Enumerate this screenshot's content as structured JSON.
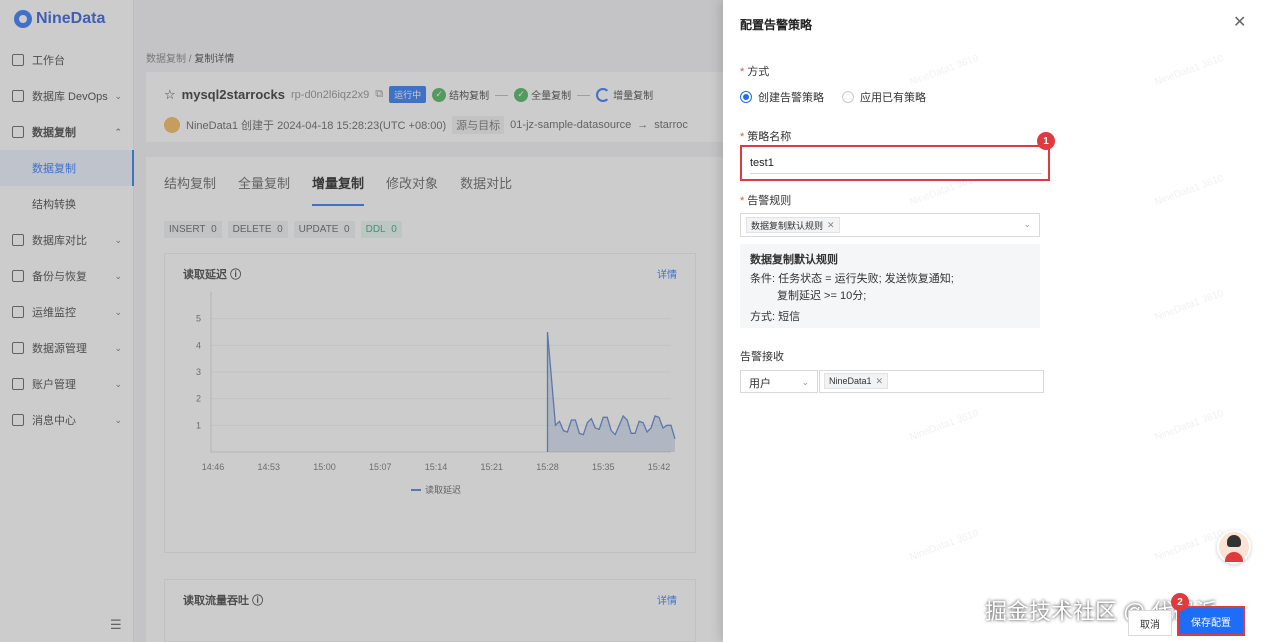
{
  "app": {
    "logo": "NineData"
  },
  "sidebar": {
    "items": [
      {
        "label": "工作台",
        "icon": "home-icon",
        "chevron": ""
      },
      {
        "label": "数据库 DevOps",
        "icon": "database-icon",
        "chevron": "⌄"
      },
      {
        "label": "数据复制",
        "icon": "copy-icon",
        "chevron": "⌃"
      },
      {
        "label": "数据库对比",
        "icon": "compare-icon",
        "chevron": "⌄"
      },
      {
        "label": "备份与恢复",
        "icon": "backup-icon",
        "chevron": "⌄"
      },
      {
        "label": "运维监控",
        "icon": "monitor-icon",
        "chevron": "⌄"
      },
      {
        "label": "数据源管理",
        "icon": "datasource-icon",
        "chevron": "⌄"
      },
      {
        "label": "账户管理",
        "icon": "account-icon",
        "chevron": "⌄"
      },
      {
        "label": "消息中心",
        "icon": "message-icon",
        "chevron": "⌄"
      }
    ],
    "sub_items": [
      {
        "label": "数据复制"
      },
      {
        "label": "结构转换"
      }
    ],
    "collapse_icon": "☰"
  },
  "main": {
    "breadcrumb": {
      "parent": "数据复制",
      "sep": "/",
      "current": "复制详情"
    },
    "task": {
      "star": "☆",
      "name": "mysql2starrocks",
      "id": "rp-d0n2l6iqz2x9",
      "copy_icon": "⧉",
      "status": "运行中",
      "steps": [
        "结构复制",
        "全量复制",
        "增量复制"
      ],
      "step_sep": "—",
      "check": "✓",
      "meta": "NineData1 创建于 2024-04-18 15:28:23(UTC +08:00)",
      "src_label": "源与目标",
      "src_value": "01-jz-sample-datasource",
      "arrow": "→",
      "target": "starroc"
    },
    "tabs": [
      "结构复制",
      "全量复制",
      "增量复制",
      "修改对象",
      "数据对比"
    ],
    "active_tab": 2,
    "counters": [
      {
        "label": "INSERT",
        "value": "0"
      },
      {
        "label": "DELETE",
        "value": "0"
      },
      {
        "label": "UPDATE",
        "value": "0"
      },
      {
        "label": "DDL",
        "value": "0"
      }
    ],
    "panel1": {
      "title": "读取延迟",
      "info_icon": "ⓘ",
      "link": "详情"
    },
    "panel2": {
      "title": "读取流量吞吐",
      "info_icon": "ⓘ",
      "link": "详情"
    }
  },
  "chart_data": {
    "type": "area",
    "title": "读取延迟",
    "series": [
      {
        "name": "读取延迟",
        "x": [
          "15:28",
          "15:29",
          "15:30",
          "15:31",
          "15:32",
          "15:33",
          "15:34",
          "15:35",
          "15:36",
          "15:37",
          "15:38",
          "15:39",
          "15:40",
          "15:41",
          "15:42",
          "15:43",
          "15:44"
        ],
        "values": [
          4.5,
          1.0,
          0.8,
          1.2,
          0.7,
          1.1,
          0.9,
          1.3,
          0.8,
          1.0,
          1.2,
          0.7,
          1.1,
          0.9,
          1.3,
          1.0,
          0.5
        ]
      }
    ],
    "xticks": [
      "14:46",
      "14:53",
      "15:00",
      "15:07",
      "15:14",
      "15:21",
      "15:28",
      "15:35",
      "15:42"
    ],
    "yticks": [
      "1",
      "2",
      "3",
      "4",
      "5"
    ],
    "ylim": [
      0,
      6
    ],
    "grid": true,
    "legend": "bottom",
    "color": "#4a78c8"
  },
  "drawer": {
    "title": "配置告警策略",
    "close_icon": "✕",
    "method": {
      "label": "方式",
      "required": "*",
      "options": [
        {
          "label": "创建告警策略",
          "checked": true
        },
        {
          "label": "应用已有策略",
          "checked": false
        }
      ]
    },
    "name": {
      "label": "策略名称",
      "required": "*",
      "value": "test1",
      "badge": "1"
    },
    "rules": {
      "label": "告警规则",
      "required": "*",
      "tag": "数据复制默认规则",
      "tag_close": "✕",
      "chevron": "⌄",
      "detail_title": "数据复制默认规则",
      "cond_line1": "条件: 任务状态 = 运行失败; 发送恢复通知;",
      "cond_line2": "复制延迟 >= 10分;",
      "method_line": "方式: 短信"
    },
    "receiver": {
      "label": "告警接收",
      "type": "用户",
      "chevron": "⌄",
      "user_tag": "NineData1",
      "tag_close": "✕"
    },
    "watermark": "NineData1 3610",
    "cancel": "取消",
    "save": "保存配置",
    "save_badge": "2",
    "community": "掘金技术社区 @ 代码派"
  },
  "colors": {
    "accent": "#1d6df7",
    "annotation": "#e0393e",
    "success": "#3dae4f"
  }
}
